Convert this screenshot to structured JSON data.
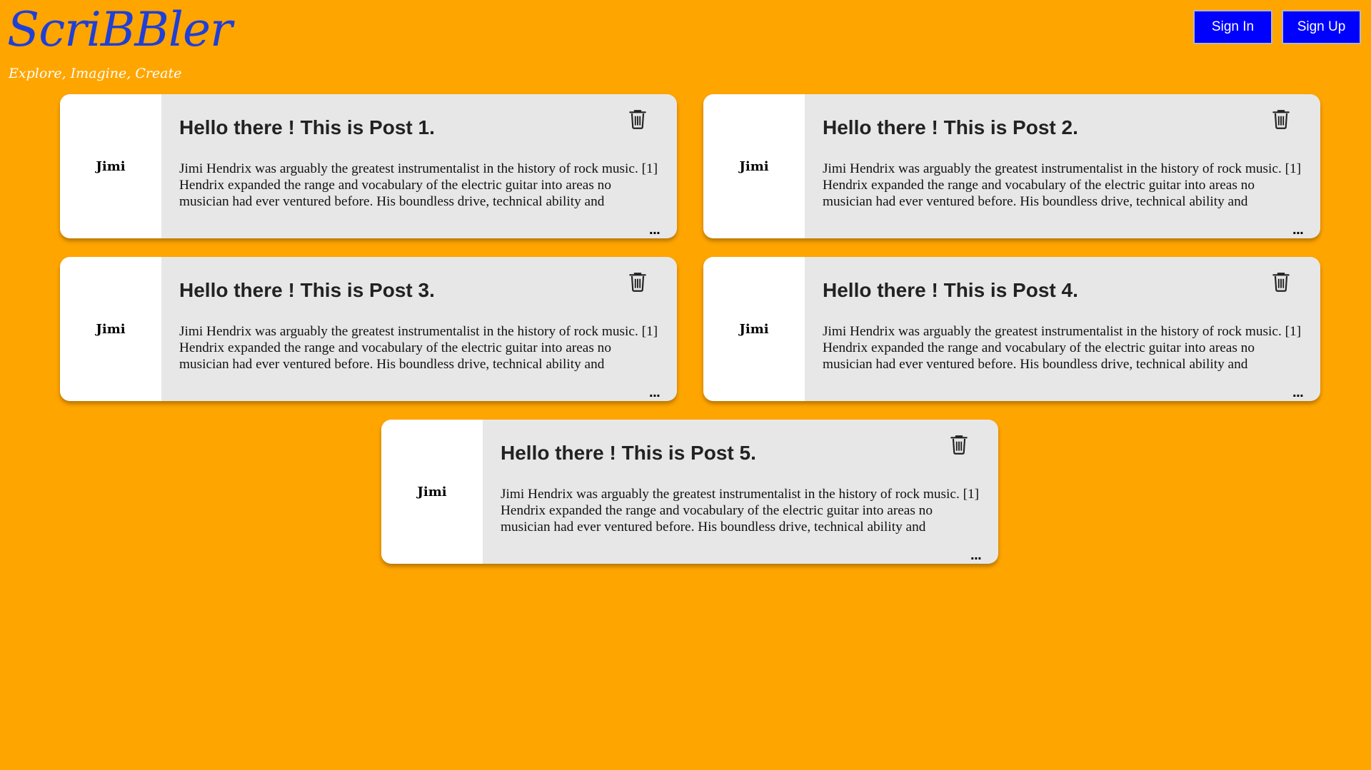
{
  "header": {
    "logo": "ScriBBler",
    "tagline": "Explore, Imagine, Create",
    "sign_in_label": "Sign In",
    "sign_up_label": "Sign Up"
  },
  "posts": [
    {
      "author": "Jimi",
      "title": "Hello there ! This is Post 1.",
      "body": "Jimi Hendrix was arguably the greatest instrumentalist in the history of rock music. [1] Hendrix expanded the range and vocabulary of the electric guitar into areas no musician had ever ventured before. His boundless drive, technical ability and",
      "more": "..."
    },
    {
      "author": "Jimi",
      "title": "Hello there ! This is Post 2.",
      "body": "Jimi Hendrix was arguably the greatest instrumentalist in the history of rock music. [1] Hendrix expanded the range and vocabulary of the electric guitar into areas no musician had ever ventured before. His boundless drive, technical ability and",
      "more": "..."
    },
    {
      "author": "Jimi",
      "title": "Hello there ! This is Post 3.",
      "body": "Jimi Hendrix was arguably the greatest instrumentalist in the history of rock music. [1] Hendrix expanded the range and vocabulary of the electric guitar into areas no musician had ever ventured before. His boundless drive, technical ability and",
      "more": "..."
    },
    {
      "author": "Jimi",
      "title": "Hello there ! This is Post 4.",
      "body": "Jimi Hendrix was arguably the greatest instrumentalist in the history of rock music. [1] Hendrix expanded the range and vocabulary of the electric guitar into areas no musician had ever ventured before. His boundless drive, technical ability and",
      "more": "..."
    },
    {
      "author": "Jimi",
      "title": "Hello there ! This is Post 5.",
      "body": "Jimi Hendrix was arguably the greatest instrumentalist in the history of rock music. [1] Hendrix expanded the range and vocabulary of the electric guitar into areas no musician had ever ventured before. His boundless drive, technical ability and",
      "more": "..."
    }
  ],
  "colors": {
    "background": "#FFA500",
    "logo": "#1F3FD6",
    "button": "#0000FF",
    "card": "#E7E7E7"
  },
  "icons": {
    "delete": "trash-icon",
    "more": "more-icon"
  }
}
